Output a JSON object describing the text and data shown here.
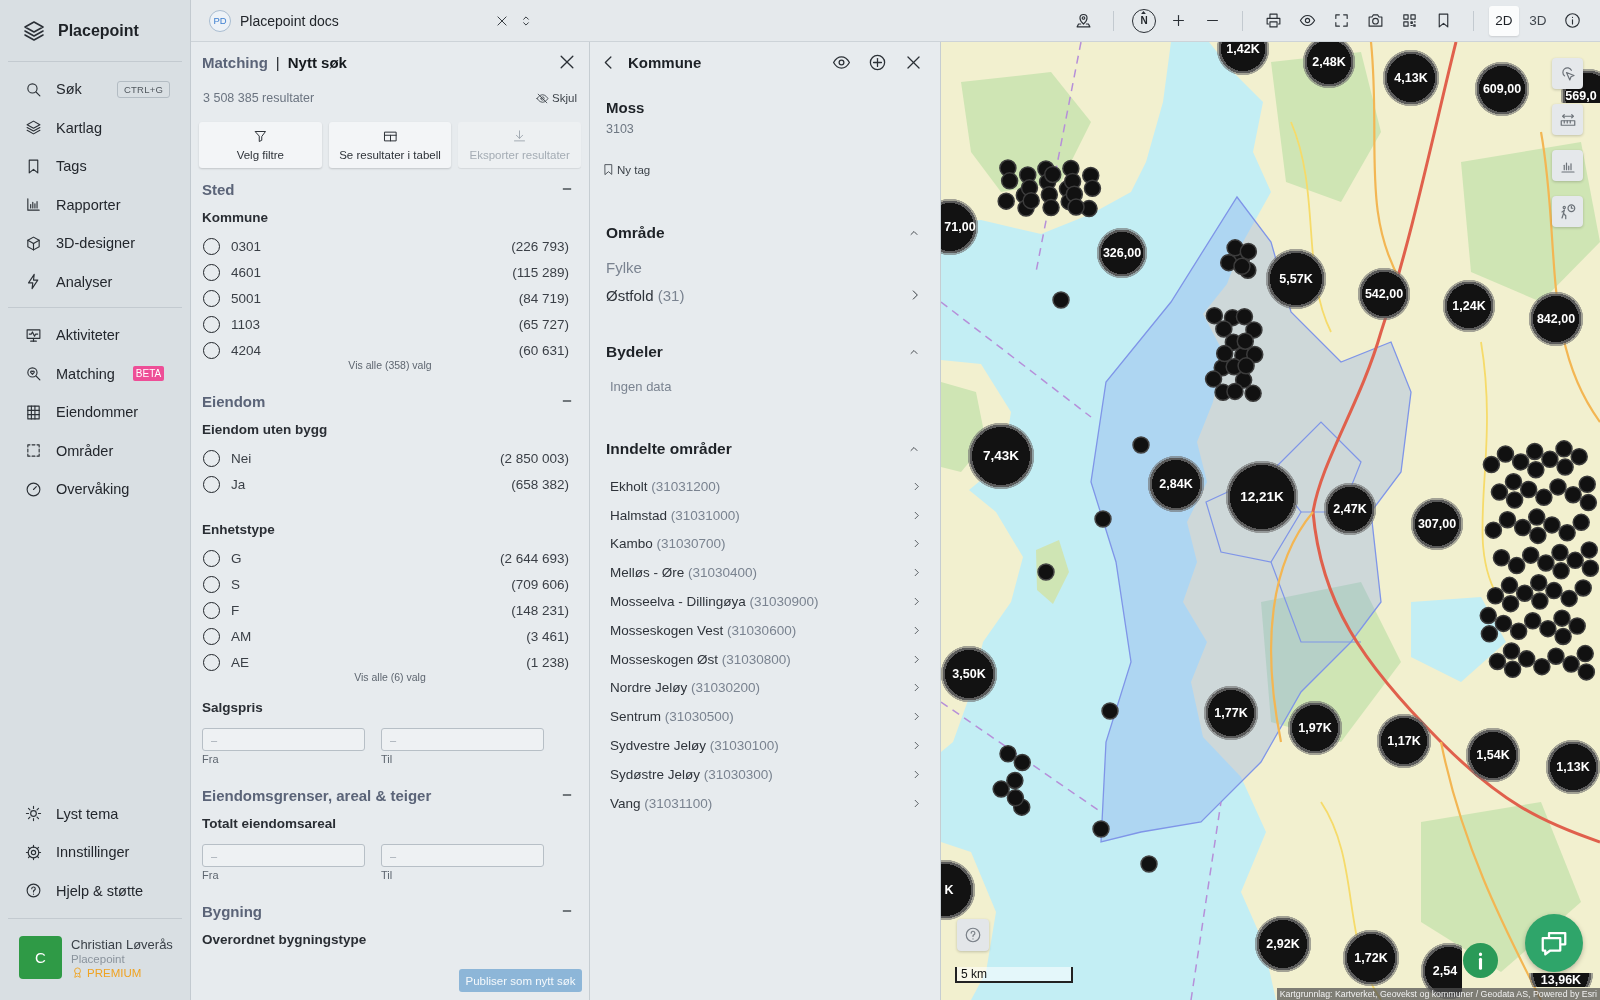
{
  "sidebar": {
    "brand": "Placepoint",
    "nav": [
      {
        "label": "Søk",
        "shortcut": "CTRL+G"
      },
      {
        "label": "Kartlag"
      },
      {
        "label": "Tags"
      },
      {
        "label": "Rapporter"
      },
      {
        "label": "3D-designer"
      },
      {
        "label": "Analyser"
      }
    ],
    "nav_secondary": [
      {
        "label": "Aktiviteter"
      },
      {
        "label": "Matching",
        "badge": "BETA"
      },
      {
        "label": "Eiendommer"
      },
      {
        "label": "Områder"
      },
      {
        "label": "Overvåking"
      }
    ],
    "footer": [
      {
        "label": "Lyst tema"
      },
      {
        "label": "Innstillinger"
      },
      {
        "label": "Hjelp & støtte"
      }
    ],
    "user": {
      "initial": "C",
      "name": "Christian Løverås",
      "organization": "Placepoint",
      "plan": "PREMIUM"
    }
  },
  "top_bar": {
    "workspace": {
      "initials": "PD",
      "name": "Placepoint docs"
    },
    "compass_label": "N",
    "view_modes": [
      {
        "label": "2D",
        "selected": true
      },
      {
        "label": "3D",
        "selected": false
      }
    ]
  },
  "filter_panel": {
    "breadcrumb": "Matching",
    "separator": "|",
    "title": "Nytt søk",
    "result_count": "3 508 385 resultater",
    "hide_label": "Skjul",
    "actions": [
      {
        "label": "Velg filtre",
        "disabled": false
      },
      {
        "label": "Se resultater i tabell",
        "disabled": false
      },
      {
        "label": "Eksporter resultater",
        "disabled": true
      }
    ],
    "sections": [
      {
        "title": "Sted",
        "expanded": true,
        "groups": [
          {
            "kind": "radio",
            "title": "Kommune",
            "options": [
              {
                "label": "0301",
                "count": "(226 793)",
                "selected": false
              },
              {
                "label": "4601",
                "count": "(115 289)",
                "selected": false
              },
              {
                "label": "5001",
                "count": "(84 719)",
                "selected": false
              },
              {
                "label": "1103",
                "count": "(65 727)",
                "selected": false
              },
              {
                "label": "4204",
                "count": "(60 631)",
                "selected": false
              }
            ],
            "show_all": "Vis alle (358) valg"
          }
        ]
      },
      {
        "title": "Eiendom",
        "expanded": true,
        "groups": [
          {
            "kind": "radio",
            "title": "Eiendom uten bygg",
            "options": [
              {
                "label": "Nei",
                "count": "(2 850 003)",
                "selected": false
              },
              {
                "label": "Ja",
                "count": "(658 382)",
                "selected": false
              }
            ]
          },
          {
            "kind": "radio",
            "title": "Enhetstype",
            "options": [
              {
                "label": "G",
                "count": "(2 644 693)",
                "selected": false
              },
              {
                "label": "S",
                "count": "(709 606)",
                "selected": false
              },
              {
                "label": "F",
                "count": "(148 231)",
                "selected": false
              },
              {
                "label": "AM",
                "count": "(3 461)",
                "selected": false
              },
              {
                "label": "AE",
                "count": "(1 238)",
                "selected": false
              }
            ],
            "show_all": "Vis alle (6) valg"
          },
          {
            "kind": "range",
            "title": "Salgspris",
            "fields": [
              {
                "placeholder": "–",
                "label": "Fra"
              },
              {
                "placeholder": "–",
                "label": "Til"
              }
            ]
          }
        ]
      },
      {
        "title": "Eiendomsgrenser, areal & teiger",
        "expanded": true,
        "groups": [
          {
            "kind": "range",
            "title": "Totalt eiendomsareal",
            "fields": [
              {
                "placeholder": "–",
                "label": "Fra"
              },
              {
                "placeholder": "–",
                "label": "Til"
              }
            ]
          }
        ]
      },
      {
        "title": "Bygning",
        "expanded": true,
        "groups": [
          {
            "kind": "radio",
            "title": "Overordnet bygningstype"
          }
        ]
      }
    ],
    "publish_button": "Publiser som nytt søk"
  },
  "detail_panel": {
    "title": "Kommune",
    "name": "Moss",
    "code": "3103",
    "tag_button": "Ny tag",
    "sections": [
      {
        "kind": "parent",
        "title": "Område",
        "expanded": true,
        "label": "Fylke",
        "items": [
          {
            "name": "Østfold",
            "code": "(31)"
          }
        ]
      },
      {
        "kind": "empty",
        "title": "Bydeler",
        "expanded": true,
        "text": "Ingen data"
      },
      {
        "kind": "children",
        "title": "Inndelte områder",
        "expanded": true,
        "items": [
          {
            "name": "Ekholt",
            "code": "(31031200)"
          },
          {
            "name": "Halmstad",
            "code": "(31031000)"
          },
          {
            "name": "Kambo",
            "code": "(31030700)"
          },
          {
            "name": "Melløs - Øre",
            "code": "(31030400)"
          },
          {
            "name": "Mosseelva - Dillingøya",
            "code": "(31030900)"
          },
          {
            "name": "Mosseskogen Vest",
            "code": "(31030600)"
          },
          {
            "name": "Mosseskogen Øst",
            "code": "(31030800)"
          },
          {
            "name": "Nordre Jeløy",
            "code": "(31030200)"
          },
          {
            "name": "Sentrum",
            "code": "(31030500)"
          },
          {
            "name": "Sydvestre Jeløy",
            "code": "(31030100)"
          },
          {
            "name": "Sydøstre Jeløy",
            "code": "(31030300)"
          },
          {
            "name": "Vang",
            "code": "(31031100)"
          }
        ]
      }
    ]
  },
  "map": {
    "clusters": [
      {
        "label": "1,42K"
      },
      {
        "label": "2,48K"
      },
      {
        "label": "4,13K"
      },
      {
        "label": "609,00"
      },
      {
        "label": "569,0"
      },
      {
        "label": "71,00"
      },
      {
        "label": "326,00"
      },
      {
        "label": "5,57K"
      },
      {
        "label": "542,00"
      },
      {
        "label": "1,24K"
      },
      {
        "label": "842,00"
      },
      {
        "label": "7,43K"
      },
      {
        "label": "2,84K"
      },
      {
        "label": "12,21K"
      },
      {
        "label": "2,47K"
      },
      {
        "label": "307,00"
      },
      {
        "label": "3,50K"
      },
      {
        "label": "1,77K"
      },
      {
        "label": "1,97K"
      },
      {
        "label": "1,17K"
      },
      {
        "label": "1,54K"
      },
      {
        "label": "1,13K"
      },
      {
        "label": "K"
      },
      {
        "label": "2,92K"
      },
      {
        "label": "1,72K"
      },
      {
        "label": "2,54"
      },
      {
        "label": "13,96K"
      }
    ],
    "scale_label": "5 km",
    "attribution": "Kartgrunnlag: Kartverket, Geovekst og kommuner / Geodata AS, Powered by Esri"
  }
}
